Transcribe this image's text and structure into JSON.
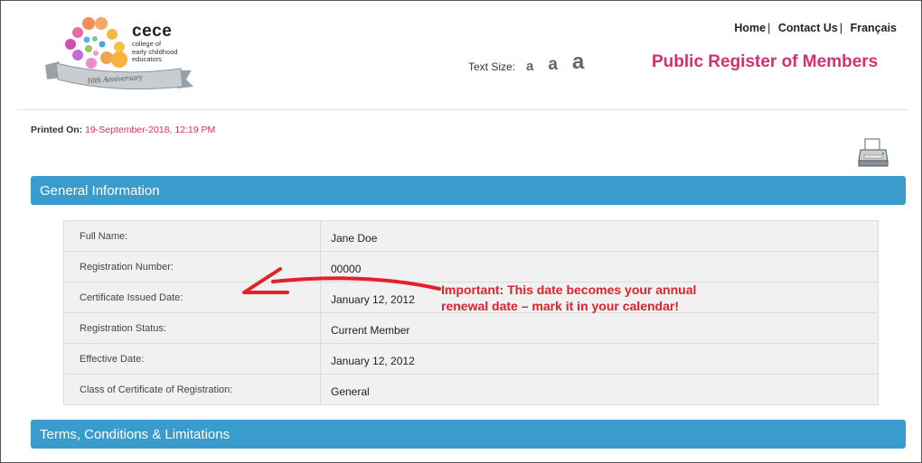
{
  "logo": {
    "name": "cece",
    "subtitle_lines": [
      "college of",
      "early childhood",
      "educators"
    ],
    "ribbon": "10th Anniversary"
  },
  "nav": {
    "home": "Home",
    "contact": "Contact Us",
    "language": "Français",
    "separator": "|"
  },
  "text_size": {
    "label": "Text Size:",
    "small": "a",
    "medium": "a",
    "large": "a"
  },
  "page_title": "Public Register of Members",
  "printed": {
    "label": "Printed On:",
    "value": "19-September-2018, 12:19 PM"
  },
  "sections": {
    "general": "General Information",
    "terms": "Terms, Conditions & Limitations"
  },
  "info_rows": [
    {
      "label": "Full Name:",
      "value": "Jane Doe"
    },
    {
      "label": "Registration Number:",
      "value": "00000"
    },
    {
      "label": "Certificate Issued Date:",
      "value": "January 12, 2012"
    },
    {
      "label": "Registration Status:",
      "value": "Current Member"
    },
    {
      "label": "Effective Date:",
      "value": "January 12, 2012"
    },
    {
      "label": "Class of Certificate of Registration:",
      "value": "General"
    }
  ],
  "annotation": {
    "line1": "Important: This date becomes your annual",
    "line2": "renewal date – mark it in your calendar!"
  },
  "colors": {
    "accent_pink": "#d5306e",
    "section_blue": "#3a9ccc",
    "annotation_red": "#e2212b"
  }
}
